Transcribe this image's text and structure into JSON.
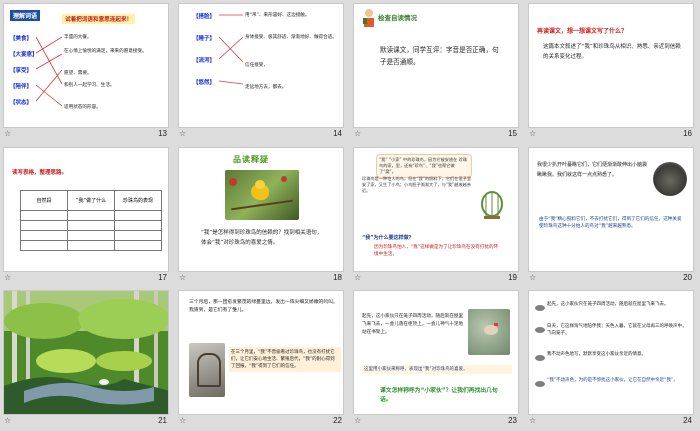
{
  "slides": [
    {
      "number": "13",
      "tag": "理解词语",
      "prompt": "试着把词语和意思连起来！",
      "left_words": [
        "【美食】",
        "【大宴席】",
        "【享受】",
        "【陪伴】",
        "【状态】"
      ],
      "right_defs": [
        "丰盛的大餐。",
        "在心情上愉悦的满足，来来的愿意接受。",
        "愿望、需要。",
        "和别人一起学习、生活。",
        "适用状态的形容。"
      ]
    },
    {
      "number": "14",
      "left_words": [
        "【搭脸】",
        "【睡子】",
        "【流泻】",
        "【悠然】"
      ],
      "right_defs": [
        "用“吊”、来形容好、这边接触。",
        "身体接受、极其舒适、渐渐地好、做得合适。",
        "信任接受，",
        "走远地方去，都去。"
      ]
    },
    {
      "number": "15",
      "heading": "检查自读情况",
      "body": "默读课文，同学互评：字音是否正确，句子是否通顺。"
    },
    {
      "number": "16",
      "question": "再读课文，想一想课文写了什么？",
      "answer": "这篇本文叙述了“我”和珍珠鸟从相识、熟悉、亲近到信赖的关系变化过程。"
    },
    {
      "number": "17",
      "caption": "读写表格，整理思路。",
      "headers": [
        "自然段",
        "“我”做了什么",
        "珍珠鸟的表现"
      ],
      "rows": 4
    },
    {
      "number": "18",
      "title": "品读释疑",
      "question": "“我”是怎样得到珍珠鸟的信赖的？找到相关语句，体会“我”对珍珠鸟的喜爱之情。"
    },
    {
      "number": "19",
      "bubble_text": "“我” “小家” 中的珍珠鸟，因为它被安放在 珍珠鸟的家，里，还有“珍鸟”、“我”也帮它做了“窝”。",
      "body_text": "珍珠鸟是一种怕人的鸟，但在“我”的照料下，它们在笼子里安了家，又生了小鸟；小鸟胆子渐渐大了，与“我”越来越亲近。",
      "question": "“我”为什么要这样做？",
      "answer": "因为珍珠鸟怕人，“我”这样做是为了让珍珠鸟在没有打扰的环境中生活。"
    },
    {
      "number": "20",
      "top_text": "我很少扒开叶蔓瞧它们，它们便渐渐敢伸出小脑袋瞅瞅我。我们就这样一点点熟悉了。",
      "bottom_text": "由于“我”精心照料它们，不去打扰它们，得到了它们的信任，这种关爱使珍珠鸟这种十分怕人的鸟对“我”越来越熟悉。"
    },
    {
      "number": "21"
    },
    {
      "number": "22",
      "top_text": "三个月后，那一团愈发繁茂的绿蔓里边，发出一阵尖细又娇嫩的鸣叫。我猜到，是它们有了雏儿。",
      "bottom_text": "在三个月里，“我”不曾偷看过珍珠鸟，也没有打扰它们，让它们安心地生活、繁殖后代，“我”的耐心得到了回报，“我”得到了它们的信任。"
    },
    {
      "number": "23",
      "top_text": "起先，这小家伙只在笼子四周活动，随后就在屋里飞来飞去，一会儿落在柜顶上，一会儿神气十足地站在书架上。",
      "note": "这里用小家伙来称呼，表现出“我”对珍珠鸟的喜爱。",
      "question": "课文怎样称呼为“小家伙”？让我们再找出几句话。"
    },
    {
      "number": "24",
      "lines": [
        "起先，这小家伙只在笼子四周活动，随后就在屋里飞来飞去。",
        "白天，它这样淘气地陪伴我；天色入暮，它就在父母再三的呼唤声中，飞向笼子。",
        "我不动声色地写，默默享受这小家伙亲近的情意。",
        "“我”不动声色，为的是不惊扰这小家伙，让它在自然中亲近“我”。"
      ]
    }
  ],
  "colors": {
    "background": "#dcdcdc",
    "slide": "#ffffff",
    "blue_tag": "#1a2fd6",
    "red": "#d11b1b",
    "green": "#4e9c1f",
    "cream": "#fff1d9"
  }
}
